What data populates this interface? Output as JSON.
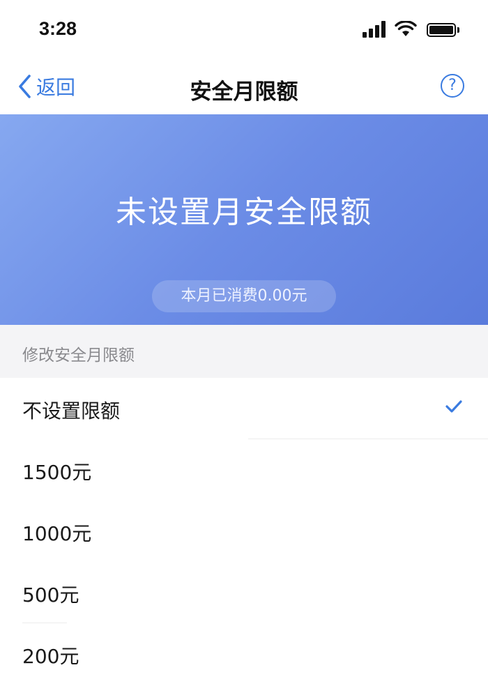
{
  "status_bar": {
    "time": "3:28",
    "icons": [
      "signal-icon",
      "wifi-icon",
      "battery-icon"
    ]
  },
  "nav": {
    "back_label": "返回",
    "title": "安全月限额",
    "help_label": "?"
  },
  "banner": {
    "title": "未设置月安全限额",
    "spent_text": "本月已消费0.00元"
  },
  "section": {
    "header": "修改安全月限额"
  },
  "options": [
    {
      "label": "不设置限额",
      "selected": true
    },
    {
      "label": "1500元",
      "selected": false
    },
    {
      "label": "1000元",
      "selected": false
    },
    {
      "label": "500元",
      "selected": false
    },
    {
      "label": "200元",
      "selected": false
    }
  ],
  "colors": {
    "accent": "#3a7be0",
    "banner_start": "#86a8f0",
    "banner_end": "#5a7bdc",
    "section_bg": "#f4f4f6"
  }
}
